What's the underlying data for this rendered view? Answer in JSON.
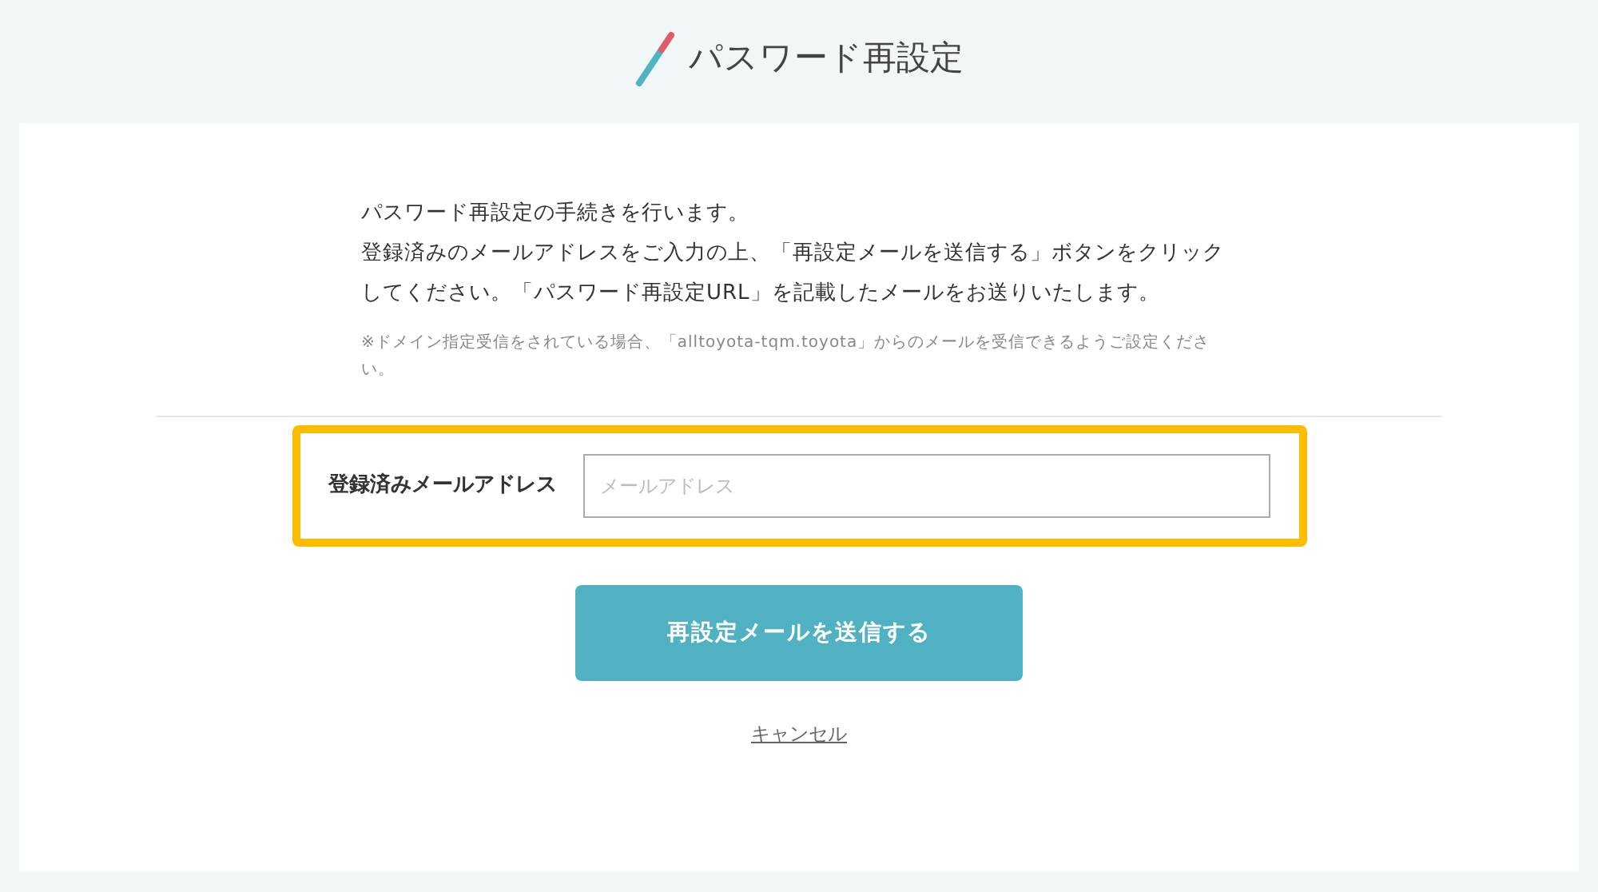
{
  "header": {
    "title": "パスワード再設定"
  },
  "intro": [
    "パスワード再設定の手続きを行います。",
    "登録済みのメールアドレスをご入力の上、「再設定メールを送信する」ボタンをクリックしてください。「パスワード再設定URL」を記載したメールをお送りいたします。"
  ],
  "note": "※ドメイン指定受信をされている場合、「alltoyota-tqm.toyota」からのメールを受信できるようご設定ください。",
  "email_field": {
    "label": "登録済みメールアドレス",
    "placeholder": "メールアドレス",
    "highlighted": true
  },
  "submit_button": "再設定メールを送信する",
  "cancel_link": "キャンセル"
}
